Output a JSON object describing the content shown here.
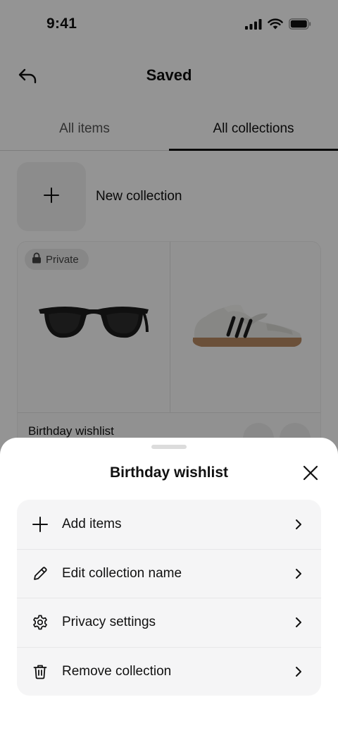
{
  "status_bar": {
    "time": "9:41",
    "icons": [
      "signal-icon",
      "wifi-icon",
      "battery-icon"
    ]
  },
  "header": {
    "title": "Saved",
    "back_icon": "back-arrow-icon"
  },
  "tabs": [
    {
      "label": "All items",
      "active": false
    },
    {
      "label": "All collections",
      "active": true
    }
  ],
  "new_collection": {
    "label": "New collection",
    "icon": "plus-icon"
  },
  "collection_card": {
    "badge": "Private",
    "badge_icon": "lock-icon",
    "name": "Birthday wishlist",
    "items": [
      "sunglasses-image",
      "sneaker-image"
    ]
  },
  "sheet": {
    "title": "Birthday wishlist",
    "close_icon": "close-icon",
    "items": [
      {
        "label": "Add items",
        "icon": "plus-icon"
      },
      {
        "label": "Edit collection name",
        "icon": "pencil-icon"
      },
      {
        "label": "Privacy settings",
        "icon": "gear-icon"
      },
      {
        "label": "Remove collection",
        "icon": "trash-icon"
      }
    ]
  },
  "colors": {
    "text": "#111111",
    "sheet_menu_bg": "#f5f5f6",
    "scrim": "rgba(0,0,0,0.42)"
  }
}
